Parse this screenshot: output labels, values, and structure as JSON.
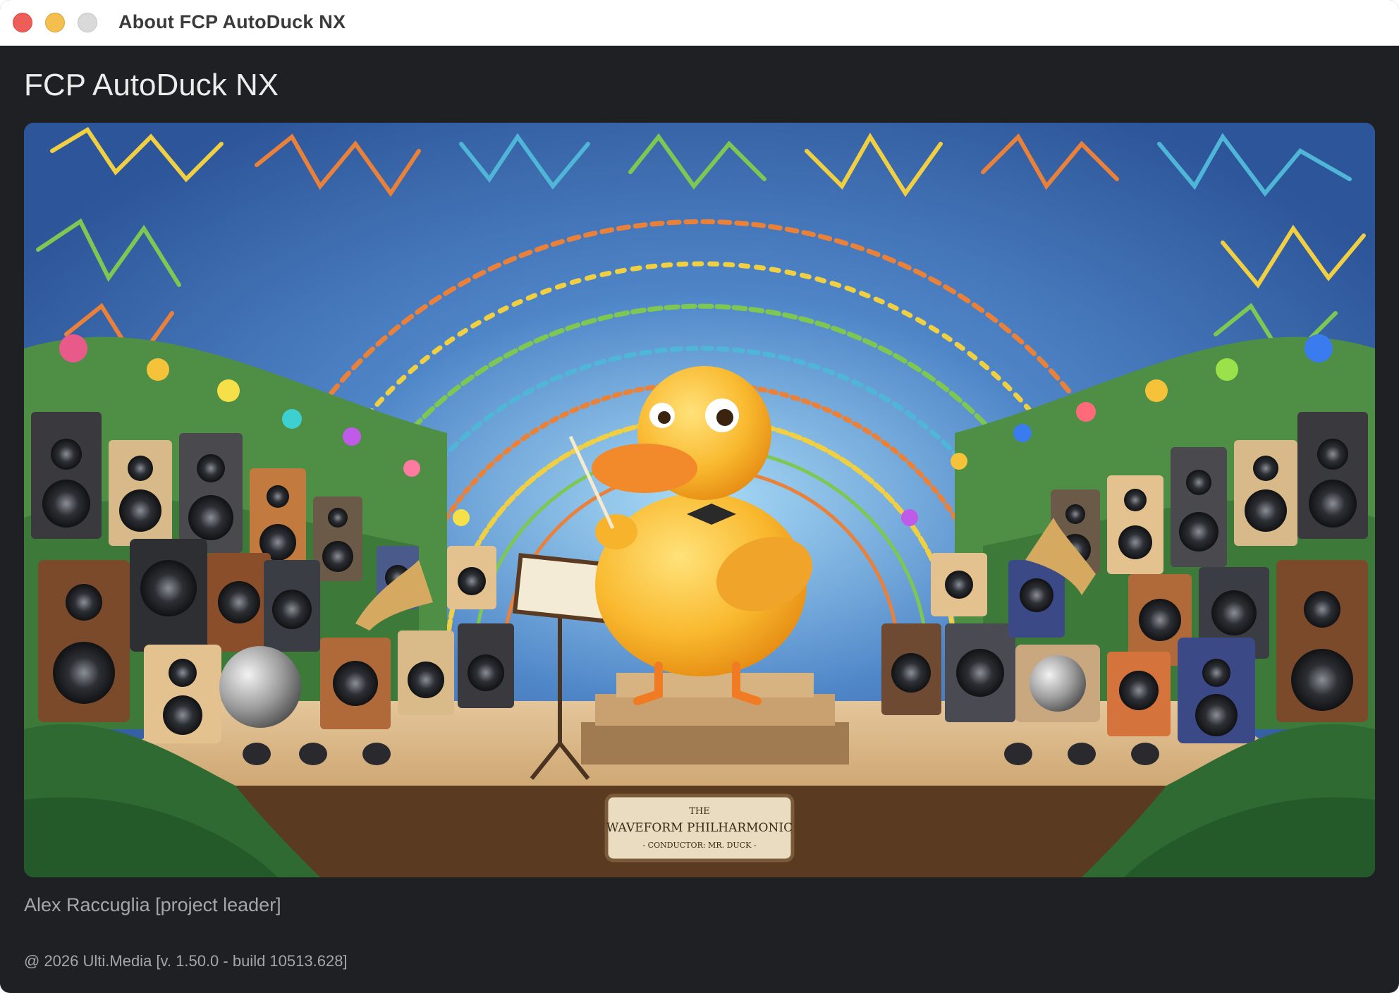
{
  "window": {
    "title": "About FCP AutoDuck NX"
  },
  "about": {
    "app_name": "FCP AutoDuck NX",
    "artwork": {
      "plaque_line1": "THE",
      "plaque_line2": "WAVEFORM PHILHARMONIC",
      "plaque_line3": "- CONDUCTOR: MR. DUCK -"
    },
    "credit": "Alex Raccuglia [project leader]",
    "copyright": "@ 2026 Ulti.Media [v. 1.50.0 - build 10513.628]"
  }
}
